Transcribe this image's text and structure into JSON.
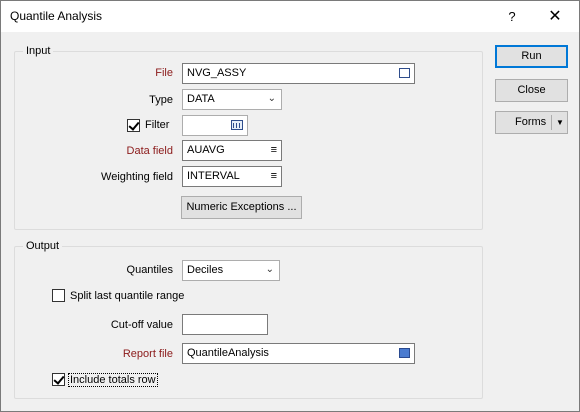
{
  "window": {
    "title": "Quantile Analysis",
    "help_label": "?",
    "close_label": "✕"
  },
  "input": {
    "group_label": "Input",
    "file_label": "File",
    "file_value": "NVG_ASSY",
    "type_label": "Type",
    "type_value": "DATA",
    "filter_label": "Filter",
    "filter_checked": true,
    "filter_value": "",
    "data_field_label": "Data field",
    "data_field_value": "AUAVG",
    "weighting_field_label": "Weighting field",
    "weighting_field_value": "INTERVAL",
    "numeric_exceptions_label": "Numeric Exceptions ..."
  },
  "output": {
    "group_label": "Output",
    "quantiles_label": "Quantiles",
    "quantiles_value": "Deciles",
    "split_last_label": "Split last quantile range",
    "split_last_checked": false,
    "cutoff_label": "Cut-off value",
    "cutoff_value": "",
    "report_file_label": "Report file",
    "report_file_value": "QuantileAnalysis",
    "include_totals_label": "Include totals row",
    "include_totals_checked": true
  },
  "buttons": {
    "run_label": "Run",
    "close_label": "Close",
    "forms_label": "Forms"
  },
  "icons": {
    "file_browse": "file-browse-icon",
    "filter_builder": "filter-builder-icon",
    "field_list": "field-list-icon",
    "dropdown": "chevron-down-icon"
  }
}
